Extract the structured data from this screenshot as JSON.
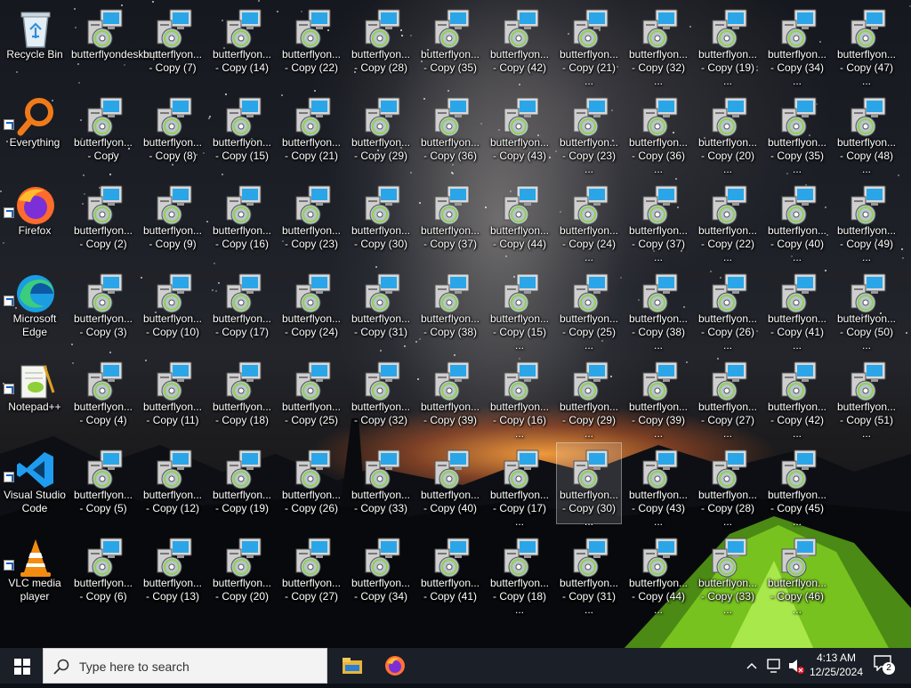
{
  "desktop": {
    "system_icons": [
      {
        "label": "Recycle Bin",
        "icon": "recycle-bin-icon"
      },
      {
        "label": "Everything",
        "icon": "everything-search-icon"
      },
      {
        "label": "Firefox",
        "icon": "firefox-icon"
      },
      {
        "label": "Microsoft Edge",
        "icon": "edge-icon"
      },
      {
        "label": "Notepad++",
        "icon": "notepadpp-icon"
      },
      {
        "label": "Visual Studio Code",
        "icon": "vscode-icon"
      },
      {
        "label": "VLC media player",
        "icon": "vlc-icon"
      }
    ],
    "columns": [
      [
        "butterflyondesktop",
        "butterflyon... - Copy",
        "butterflyon... - Copy (2)",
        "butterflyon... - Copy (3)",
        "butterflyon... - Copy (4)",
        "butterflyon... - Copy (5)",
        "butterflyon... - Copy (6)"
      ],
      [
        "butterflyon... - Copy (7)",
        "butterflyon... - Copy (8)",
        "butterflyon... - Copy (9)",
        "butterflyon... - Copy (10)",
        "butterflyon... - Copy (11)",
        "butterflyon... - Copy (12)",
        "butterflyon... - Copy (13)"
      ],
      [
        "butterflyon... - Copy (14)",
        "butterflyon... - Copy (15)",
        "butterflyon... - Copy (16)",
        "butterflyon... - Copy (17)",
        "butterflyon... - Copy (18)",
        "butterflyon... - Copy (19)",
        "butterflyon... - Copy (20)"
      ],
      [
        "butterflyon... - Copy (22)",
        "butterflyon... - Copy (21)",
        "butterflyon... - Copy (23)",
        "butterflyon... - Copy (24)",
        "butterflyon... - Copy (25)",
        "butterflyon... - Copy (26)",
        "butterflyon... - Copy (27)"
      ],
      [
        "butterflyon... - Copy (28)",
        "butterflyon... - Copy (29)",
        "butterflyon... - Copy (30)",
        "butterflyon... - Copy (31)",
        "butterflyon... - Copy (32)",
        "butterflyon... - Copy (33)",
        "butterflyon... - Copy (34)"
      ],
      [
        "butterflyon... - Copy (35)",
        "butterflyon... - Copy (36)",
        "butterflyon... - Copy (37)",
        "butterflyon... - Copy (38)",
        "butterflyon... - Copy (39)",
        "butterflyon... - Copy (40)",
        "butterflyon... - Copy (41)"
      ],
      [
        "butterflyon... - Copy (42)",
        "butterflyon... - Copy (43)",
        "butterflyon... - Copy (44)",
        "butterflyon... - Copy (15) ...",
        "butterflyon... - Copy (16) ...",
        "butterflyon... - Copy (17) ...",
        "butterflyon... - Copy (18) ..."
      ],
      [
        "butterflyon... - Copy (21) ...",
        "butterflyon... - Copy (23) ...",
        "butterflyon... - Copy (24) ...",
        "butterflyon... - Copy (25) ...",
        "butterflyon... - Copy (29) ...",
        "butterflyon... - Copy (30) ...",
        "butterflyon... - Copy (31) ..."
      ],
      [
        "butterflyon... - Copy (32) ...",
        "butterflyon... - Copy (36) ...",
        "butterflyon... - Copy (37) ...",
        "butterflyon... - Copy (38) ...",
        "butterflyon... - Copy (39) ...",
        "butterflyon... - Copy (43) ...",
        "butterflyon... - Copy (44) ..."
      ],
      [
        "butterflyon... - Copy (19) ...",
        "butterflyon... - Copy (20) ...",
        "butterflyon... - Copy (22) ...",
        "butterflyon... - Copy (26) ...",
        "butterflyon... - Copy (27) ...",
        "butterflyon... - Copy (28) ...",
        "butterflyon... - Copy (33) ..."
      ],
      [
        "butterflyon... - Copy (34) ...",
        "butterflyon... - Copy (35) ...",
        "butterflyon... - Copy (40) ...",
        "butterflyon... - Copy (41) ...",
        "butterflyon... - Copy (42) ...",
        "butterflyon... - Copy (45) ...",
        "butterflyon... - Copy (46) ..."
      ],
      [
        "butterflyon... - Copy (47) ...",
        "butterflyon... - Copy (48) ...",
        "butterflyon... - Copy (49) ...",
        "butterflyon... - Copy (50) ...",
        "butterflyon... - Copy (51) ..."
      ]
    ],
    "selected_label": "butterflyon... - Copy (30) ..."
  },
  "taskbar": {
    "search_placeholder": "Type here to search",
    "pinned": [
      "file-explorer-icon",
      "firefox-icon"
    ],
    "clock_time": "4:13 AM",
    "clock_date": "12/25/2024",
    "notification_count": "2"
  }
}
